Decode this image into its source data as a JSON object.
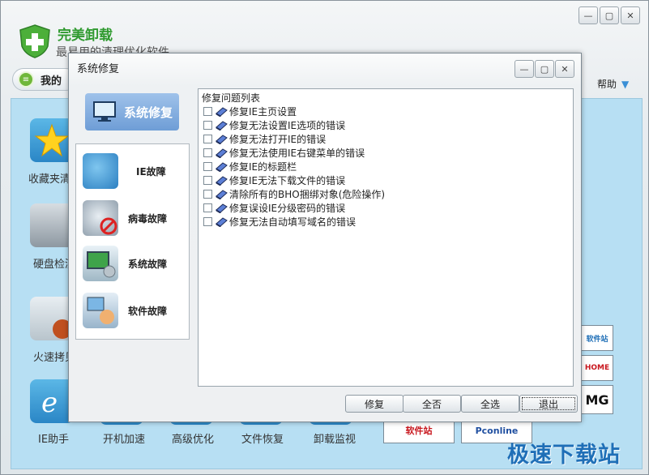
{
  "app": {
    "title": "完美卸载",
    "subtitle": "最易用的清理优化软件",
    "mine_tab": "我的",
    "help": "帮助"
  },
  "tiles": [
    {
      "label": "收藏夹清"
    },
    {
      "label": "硬盘检测"
    },
    {
      "label": "火速拷贝"
    },
    {
      "label": "IE助手"
    }
  ],
  "bottom_tools": [
    "开机加速",
    "高级优化",
    "文件恢复",
    "卸载监视"
  ],
  "dialog": {
    "title": "系统修复",
    "side_active": "系统修复",
    "side_items": [
      {
        "label": "IE故障",
        "icon": "ie-wrench-icon"
      },
      {
        "label": "病毒故障",
        "icon": "virus-block-icon"
      },
      {
        "label": "系统故障",
        "icon": "system-gear-icon"
      },
      {
        "label": "软件故障",
        "icon": "software-hand-icon"
      }
    ],
    "list_header": "修复问题列表",
    "list_items": [
      "修复IE主页设置",
      "修复无法设置IE选项的错误",
      "修复无法打开IE的错误",
      "修复无法使用IE右键菜单的错误",
      "修复IE的标题栏",
      "修复IE无法下载文件的错误",
      "清除所有的BHO捆绑对象(危险操作)",
      "修复误设IE分级密码的错误",
      "修复无法自动填写域名的错误"
    ],
    "buttons": {
      "repair": "修复",
      "select_none": "全否",
      "select_all": "全选",
      "exit": "退出"
    }
  },
  "ads": {
    "ad1": "软件站",
    "ad2": "HOME",
    "ad3": "MG",
    "ad4": "软件站",
    "ad5": "Pconline"
  },
  "watermark": "极速下载站",
  "colors": {
    "accent": "#6e9dd6",
    "brand_green": "#2f9a2f",
    "content_bg": "#b7dff3"
  }
}
